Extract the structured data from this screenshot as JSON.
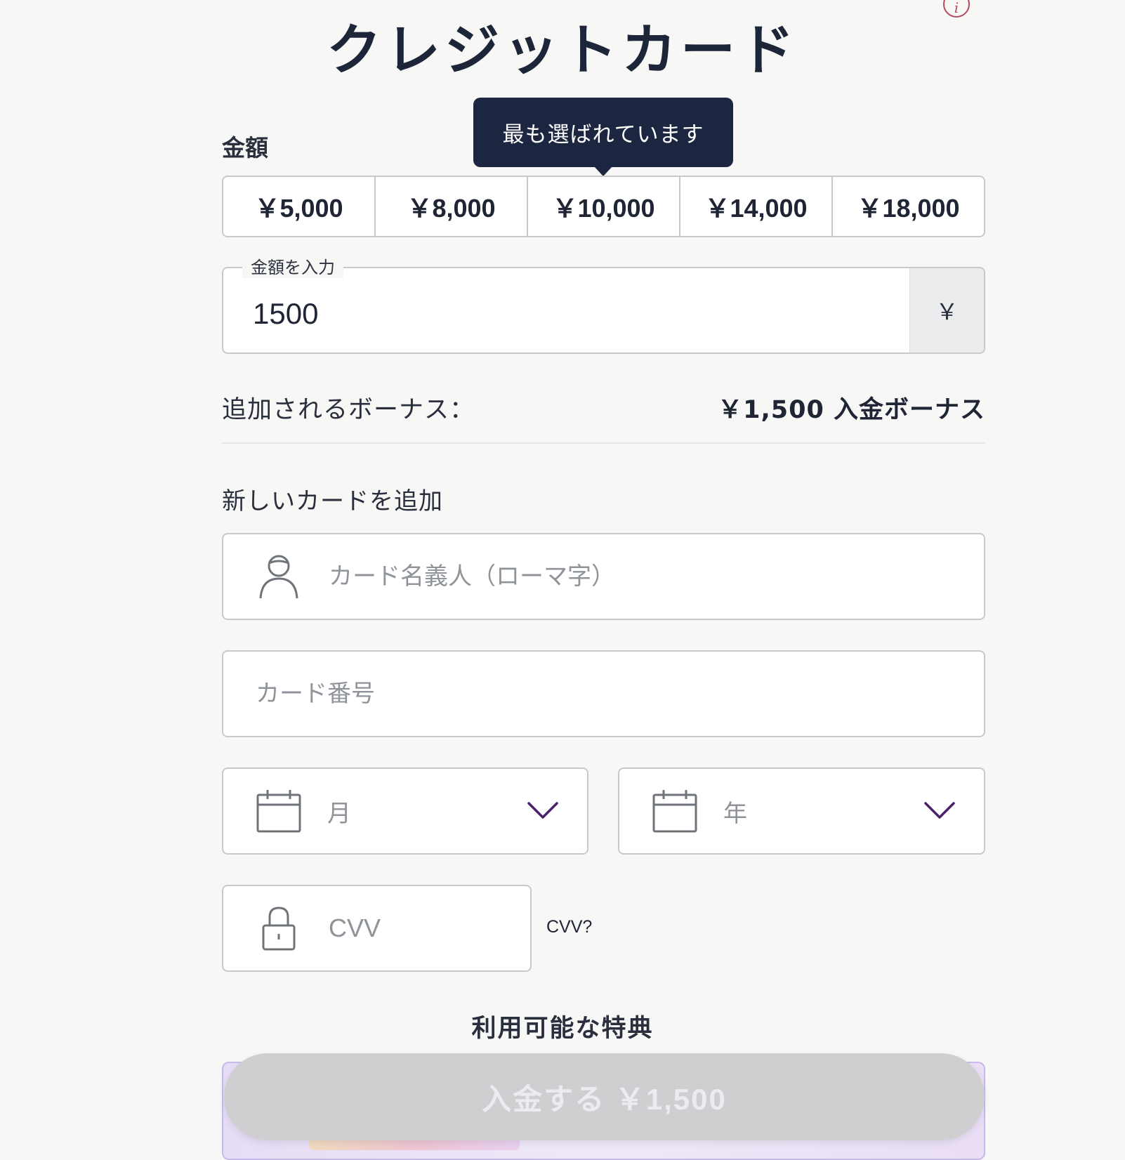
{
  "header": {
    "title": "クレジットカード"
  },
  "amount": {
    "label": "金額",
    "tooltip": "最も選ばれています",
    "presets": [
      "￥5,000",
      "￥8,000",
      "￥10,000",
      "￥14,000",
      "￥18,000"
    ],
    "input_legend": "金額を入力",
    "input_value": "1500",
    "currency_symbol": "￥"
  },
  "bonus": {
    "label": "追加されるボーナス：",
    "value": "￥1,500 入金ボーナス"
  },
  "card": {
    "section_title": "新しいカードを追加",
    "name_placeholder": "カード名義人（ローマ字）",
    "number_placeholder": "カード番号",
    "month_placeholder": "月",
    "year_placeholder": "年",
    "cvv_placeholder": "CVV",
    "cvv_help": "CVV?"
  },
  "offers": {
    "title": "利用可能な特典"
  },
  "deposit_button": {
    "label": "入金する ￥1,500"
  },
  "colors": {
    "primary_dark": "#1c2640",
    "accent_chevron": "#4a1f6e",
    "info_icon": "#b64a5e",
    "button_disabled": "#cfcfd2"
  }
}
